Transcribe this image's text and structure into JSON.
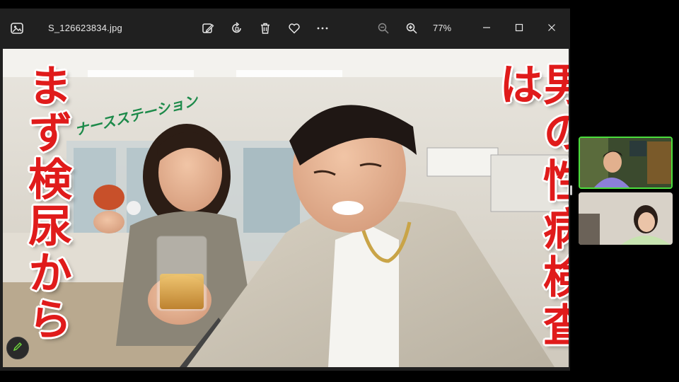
{
  "viewer": {
    "filename": "S_126623834.jpg",
    "zoom_level": "77%",
    "toolbar_icons": [
      "edit-image-icon",
      "rotate-icon",
      "delete-icon",
      "favorite-icon",
      "more-icon"
    ],
    "zoom_icons": [
      "zoom-out-icon",
      "zoom-in-icon"
    ],
    "window_icons": [
      "minimize-icon",
      "maximize-icon",
      "close-icon"
    ]
  },
  "photo": {
    "sign_text": "ナースステーション",
    "caption_left": "まず検尿から",
    "caption_right": "男の性病検査は"
  },
  "colors": {
    "caption_red": "#e01b1b",
    "active_speaker_border": "#4ade3c",
    "titlebar_bg": "#202020"
  }
}
